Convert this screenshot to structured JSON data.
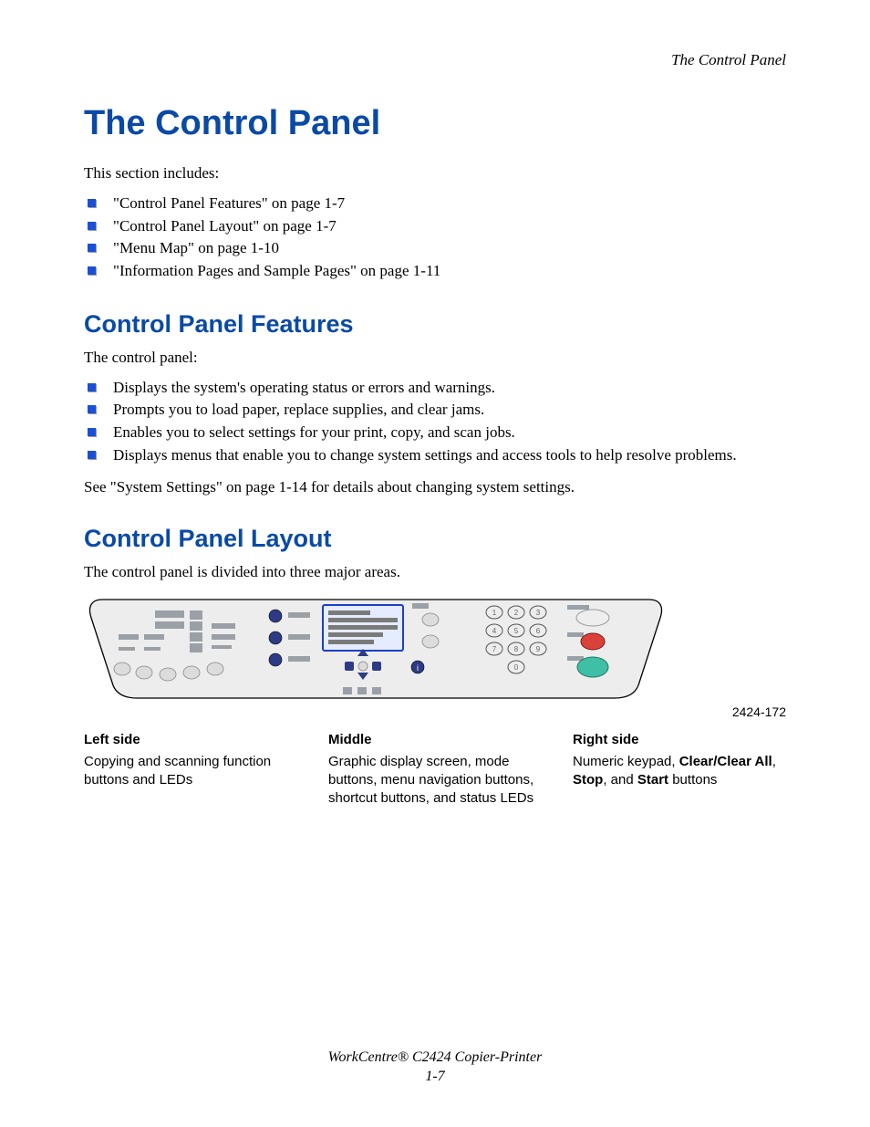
{
  "running_head": "The Control Panel",
  "title": "The Control Panel",
  "intro": "This section includes:",
  "toc": [
    "\"Control Panel Features\" on page 1-7",
    "\"Control Panel Layout\" on page 1-7",
    "\"Menu Map\" on page 1-10",
    "\"Information Pages and Sample Pages\" on page 1-11"
  ],
  "features": {
    "heading": "Control Panel Features",
    "lead": "The control panel:",
    "items": [
      "Displays the system's operating status or errors and warnings.",
      "Prompts you to load paper, replace supplies, and clear jams.",
      "Enables you to select settings for your print, copy, and scan jobs.",
      "Displays menus that enable you to change system settings and access tools to help resolve problems."
    ],
    "see": "See \"System Settings\" on page 1-14 for details about changing system settings."
  },
  "layout": {
    "heading": "Control Panel Layout",
    "lead": "The control panel is divided into three major areas.",
    "figure_id": "2424-172",
    "columns": [
      {
        "head": "Left side",
        "body_plain": "Copying and scanning function buttons and LEDs"
      },
      {
        "head": "Middle",
        "body_plain": "Graphic display screen, mode buttons, menu navigation buttons, shortcut buttons, and status LEDs"
      },
      {
        "head": "Right side",
        "body_html": "Numeric keypad, <span class=\"bold\">Clear/Clear All</span>, <span class=\"bold\">Stop</span>, and <span class=\"bold\">Start</span> buttons"
      }
    ]
  },
  "footer": {
    "product": "WorkCentre® C2424 Copier-Printer",
    "page": "1-7"
  }
}
